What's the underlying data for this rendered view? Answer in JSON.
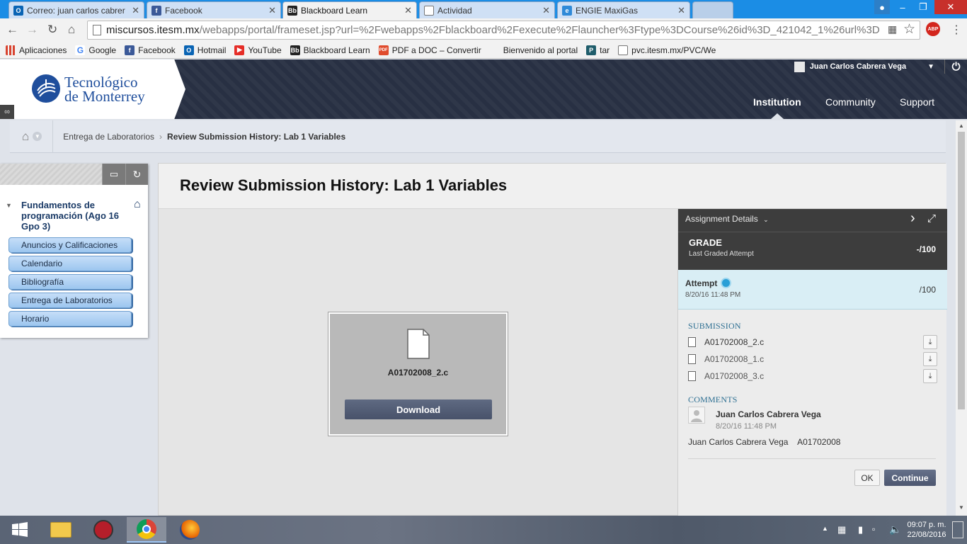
{
  "browser": {
    "tabs": [
      {
        "label": "Correo: juan carlos cabrer",
        "favicon": "outlook-icon",
        "active": false
      },
      {
        "label": "Facebook",
        "favicon": "facebook-icon",
        "active": false
      },
      {
        "label": "Blackboard Learn",
        "favicon": "blackboard-icon",
        "active": true
      },
      {
        "label": "Actividad",
        "favicon": "page-icon",
        "active": false
      },
      {
        "label": "ENGIE MaxiGas",
        "favicon": "ie-icon",
        "active": false
      }
    ],
    "close_glyph": "✕",
    "address": {
      "host": "miscursos.itesm.mx",
      "path": "/webapps/portal/frameset.jsp?url=%2Fwebapps%2Fblackboard%2Fexecute%2Flauncher%3Ftype%3DCourse%26id%3D_421042_1%26url%3D"
    },
    "abp_label": "ABP",
    "bookmarks": [
      {
        "label": "Aplicaciones",
        "icon": "apps-grid-icon"
      },
      {
        "label": "Google",
        "icon": "google-icon"
      },
      {
        "label": "Facebook",
        "icon": "facebook-icon"
      },
      {
        "label": "Hotmail",
        "icon": "outlook-icon"
      },
      {
        "label": "YouTube",
        "icon": "youtube-icon"
      },
      {
        "label": "Blackboard Learn",
        "icon": "blackboard-icon"
      },
      {
        "label": "PDF a DOC – Convertir",
        "icon": "pdf-icon"
      },
      {
        "label": "Bienvenido al portal",
        "icon": "blank-icon"
      },
      {
        "label": "tar",
        "icon": "tar-icon"
      },
      {
        "label": "pvc.itesm.mx/PVC/We",
        "icon": "page-icon"
      }
    ]
  },
  "header": {
    "logo_line1": "Tecnológico",
    "logo_line2": "de Monterrey",
    "user_name": "Juan Carlos Cabrera Vega",
    "nav": [
      {
        "label": "Institution",
        "active": true
      },
      {
        "label": "Community",
        "active": false
      },
      {
        "label": "Support",
        "active": false
      }
    ]
  },
  "breadcrumb": {
    "parent": "Entrega de Laboratorios",
    "current": "Review Submission History: Lab 1 Variables"
  },
  "course_menu": {
    "title": "Fundamentos de programación (Ago 16 Gpo 3)",
    "items": [
      "Anuncios y Calificaciones",
      "Calendario",
      "Bibliografía",
      "Entrega de Laboratorios",
      "Horario"
    ]
  },
  "page": {
    "title": "Review Submission History: Lab 1 Variables"
  },
  "preview": {
    "file_name": "A01702008_2.c",
    "download_label": "Download"
  },
  "details": {
    "header_label": "Assignment Details",
    "grade_label": "GRADE",
    "grade_sub": "Last Graded Attempt",
    "grade_value": "-/100",
    "attempt_label": "Attempt",
    "attempt_date": "8/20/16 11:48 PM",
    "attempt_value": "/100",
    "submission_label": "SUBMISSION",
    "files": [
      "A01702008_2.c",
      "A01702008_1.c",
      "A01702008_3.c"
    ],
    "comments_label": "COMMENTS",
    "comment_author": "Juan Carlos Cabrera Vega",
    "comment_date": "8/20/16 11:48 PM",
    "comment_text": "Juan Carlos Cabrera Vega    A01702008",
    "ok_label": "OK",
    "continue_label": "Continue"
  },
  "taskbar": {
    "time": "09:07 p. m.",
    "date": "22/08/2016"
  },
  "colors": {
    "chrome_blue": "#1b8de5",
    "bb_header": "#2b3244",
    "panel_dark": "#3d3d3d",
    "attempt_bg": "#d9eef5",
    "link_blue": "#2d6f92",
    "menu_item": "#9cc6ef"
  }
}
